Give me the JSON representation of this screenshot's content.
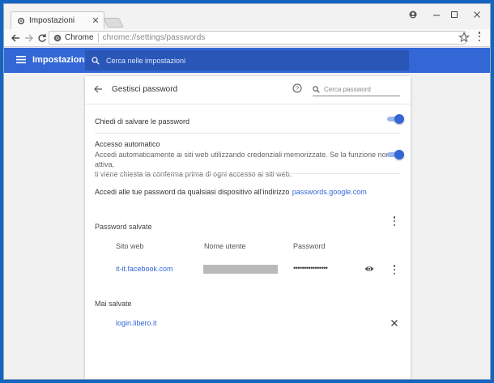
{
  "browser": {
    "tab_title": "Impostazioni",
    "chrome_label": "Chrome",
    "url_scheme": "chrome://",
    "url_path": "settings/passwords"
  },
  "header": {
    "title": "Impostazioni",
    "search_placeholder": "Cerca nelle impostazioni"
  },
  "passwords": {
    "title": "Gestisci password",
    "search_placeholder": "Cerca password",
    "offer_to_save_label": "Chiedi di salvare le password",
    "offer_to_save_enabled": true,
    "autosignin_label": "Accesso automatico",
    "autosignin_desc_line1": "Accedi automaticamente ai siti web utilizzando credenziali memorizzate. Se la funzione non è attiva,",
    "autosignin_desc_line2": "ti viene chiesta la conferma prima di ogni accesso ai siti web.",
    "autosignin_enabled": true,
    "access_text": "Accedi alle tue password da qualsiasi dispositivo all'indirizzo",
    "access_link": "passwords.google.com",
    "saved_title": "Password salvate",
    "columns": [
      "Sito web",
      "Nome utente",
      "Password"
    ],
    "saved_items": [
      {
        "site": "it-it.facebook.com",
        "password_masked": "••••••••••••••••"
      }
    ],
    "never_saved_title": "Mai salvate",
    "never_saved_items": [
      "login.libero.it"
    ]
  },
  "colors": {
    "accent": "#3367d6",
    "desktop": "#1565c0"
  }
}
